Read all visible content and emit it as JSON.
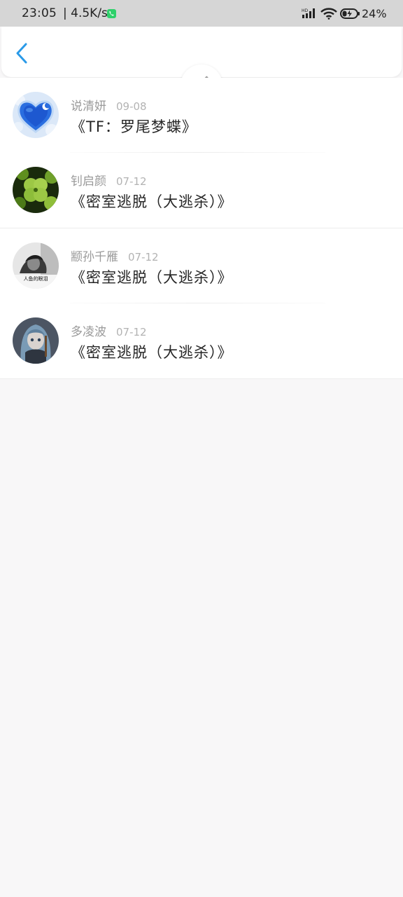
{
  "status_bar": {
    "time": "23:05",
    "network_speed": "| 4.5K/s",
    "battery_percent": "24%",
    "icons": [
      "call-icon",
      "hd-signal-icon",
      "wifi-icon",
      "battery-charging-icon"
    ]
  },
  "header": {
    "back_icon": "chevron-left-icon",
    "accent_color": "#2a9ae8"
  },
  "list": {
    "items": [
      {
        "author": "说清妍",
        "date": "09-08",
        "title": "《TF：罗尾梦蝶》",
        "avatar": "blue-heart-avatar"
      },
      {
        "author": "钊启颜",
        "date": "07-12",
        "title": "《密室逃脱（大逃杀）》",
        "avatar": "clover-avatar"
      },
      {
        "author": "颛孙千雁",
        "date": "07-12",
        "title": "《密室逃脱（大逃杀）》",
        "avatar": "bw-photo-avatar"
      },
      {
        "author": "多凌波",
        "date": "07-12",
        "title": "《密室逃脱（大逃杀）》",
        "avatar": "anime-girl-avatar"
      }
    ]
  },
  "avatar_captions": {
    "bw_photo": "人鱼的眼泪"
  },
  "colors": {
    "page_background": "#f8f7f8",
    "status_bar_background": "#d6d6d6",
    "author_text": "#9a9a9a",
    "title_text": "#262626"
  }
}
